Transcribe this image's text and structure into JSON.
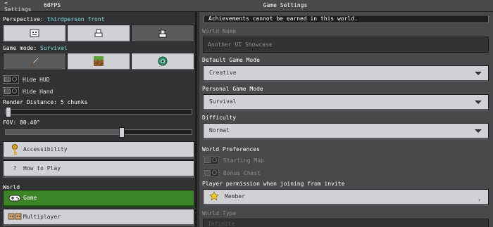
{
  "topbar": {
    "back_label": "< Settings",
    "fps": "60FPS",
    "title": "Game Settings"
  },
  "left": {
    "perspective_label": "Perspective:",
    "perspective_value": "thirdperson front",
    "game_mode_label": "Game mode:",
    "game_mode_value": "Survival",
    "hide_hud": "Hide HUD",
    "hide_hand": "Hide Hand",
    "render_distance": "Render Distance: 5 chunks",
    "render_distance_level": 0.0,
    "fov": "FOV: 80.40°",
    "fov_level": 0.63,
    "accessibility": "Accessibility",
    "how_to_play_icon": "?",
    "how_to_play": "How to Play",
    "world_header": "World",
    "game": "Game",
    "multiplayer": "Multiplayer"
  },
  "right": {
    "notice": "Achievements cannot be earned in this world.",
    "world_name_label": "World Name",
    "world_name_value": "Another UI Showcase",
    "default_mode_label": "Default Game Mode",
    "default_mode_value": "Creative",
    "personal_mode_label": "Personal Game Mode",
    "personal_mode_value": "Survival",
    "difficulty_label": "Difficulty",
    "difficulty_value": "Normal",
    "world_prefs_label": "World Preferences",
    "starting_map": "Starting Map",
    "bonus_chest": "Bonus Chest",
    "permission_label": "Player permission when joining from invite",
    "permission_value": "Member",
    "world_type_label": "World Type",
    "world_type_value": "Infinite"
  },
  "icons": {
    "perspective": [
      "firstperson-icon",
      "thirdperson-back-icon",
      "thirdperson-front-icon"
    ],
    "game_modes": [
      "sword-icon",
      "grass-block-icon",
      "ender-eye-icon"
    ]
  },
  "colors": {
    "accent": "#7fe0e0",
    "active_green": "#3c8527",
    "panel": "#48494a"
  }
}
